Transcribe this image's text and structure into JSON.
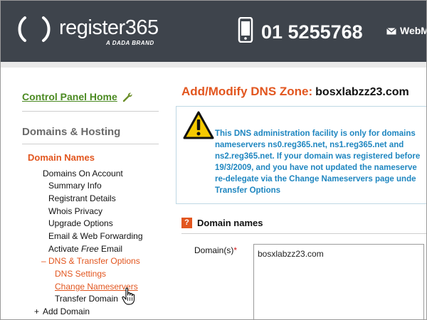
{
  "header": {
    "logo_text": "register365",
    "logo_sub": "A DADA BRAND",
    "phone_number": "01 5255768",
    "webmail_label": "WebM"
  },
  "sidebar": {
    "control_panel_home": "Control Panel Home",
    "domains_hosting": "Domains & Hosting",
    "domain_names": "Domain Names",
    "items": {
      "domains_on_account": "Domains On Account",
      "summary_info": "Summary Info",
      "registrant_details": "Registrant Details",
      "whois_privacy": "Whois Privacy",
      "upgrade_options": "Upgrade Options",
      "email_web_forwarding": "Email & Web Forwarding",
      "activate_free_email_pre": "Activate ",
      "activate_free_email_em": "Free",
      "activate_free_email_post": " Email",
      "dns_transfer_prefix": "–",
      "dns_transfer_options": "DNS & Transfer Options",
      "dns_settings": "DNS Settings",
      "change_nameservers": "Change Nameservers",
      "transfer_domain": "Transfer Domain",
      "add_domain_prefix": "+",
      "add_domain": "Add Domain"
    }
  },
  "main": {
    "title": "Add/Modify DNS Zone:",
    "title_domain": "bosxlabzz23.com",
    "notice_lines": [
      "This DNS administration facility is only for domains",
      "nameservers ns0.reg365.net, ns1.reg365.net and",
      "ns2.reg365.net. If your domain was registered before",
      "19/3/2009, and you have not updated the nameserve",
      "re-delegate via the Change Nameservers page unde",
      "Transfer Options"
    ],
    "section_icon": "?",
    "section_title": "Domain names",
    "domains_label": "Domain(s)",
    "domains_required": "*",
    "domains_value": "bosxlabzz23.com"
  },
  "colors": {
    "header_bg": "#3e444c",
    "accent_orange": "#e2561f",
    "link_green": "#4b8a22",
    "notice_blue": "#1e86c0"
  },
  "icons": {
    "phone": "phone-icon",
    "mail": "mail-icon",
    "wrench": "wrench-icon",
    "warning": "warning-icon",
    "help": "help-icon",
    "cursor": "hand-cursor-icon"
  }
}
